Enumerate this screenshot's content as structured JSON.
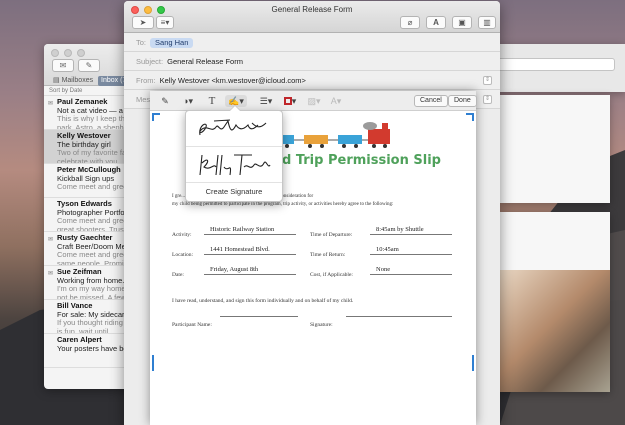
{
  "mail_list": {
    "mailboxes_label": "Mailboxes",
    "inbox_label": "Inbox (7)",
    "sort_label": "Sort by Date",
    "messages": [
      {
        "from": "Paul Zemanek",
        "subject": "Not a cat video — a new vid...",
        "preview": "This is why I keep the ball on my",
        "preview2": "park. Astro, a shepherd...",
        "flag": "envelope"
      },
      {
        "from": "Kelly Westover",
        "subject": "The birthday girl",
        "preview": "Two of my favorite faces and ones",
        "preview2": "celebrate with you.",
        "selected": true
      },
      {
        "from": "Peter McCullough",
        "subject": "Kickball Sign ups",
        "preview": "Come meet and greet, rookie players!",
        "preview2": ""
      },
      {
        "from": "Tyson Edwards",
        "subject": "Photographer Portfolio",
        "preview": "Come meet and greet, our featured",
        "preview2": "great shooters. Trust me..."
      },
      {
        "from": "Rusty Gaechter",
        "subject": "Craft Beer/Doom Metal",
        "preview": "Come meet and greet, this is the",
        "preview2": "same people. Promise...",
        "flag": "envelope"
      },
      {
        "from": "Sue Zeifman",
        "subject": "Working from home.",
        "preview": "I'm on my way home now, but I'll",
        "preview2": "not be missed. A few...",
        "flag": "envelope"
      },
      {
        "from": "Bill Vance",
        "subject": "For sale: My sidecar",
        "preview": "If you thought riding in the sidecar",
        "preview2": "is fun, wait until..."
      },
      {
        "from": "Caren Alpert",
        "subject": "Your posters have been",
        "preview": "",
        "preview2": ""
      }
    ]
  },
  "compose": {
    "window_title": "General Release Form",
    "to_label": "To:",
    "to_value": "Sang Han",
    "subject_label": "Subject:",
    "subject_value": "General Release Form",
    "from_label": "From:",
    "from_value": "Kelly Westover <km.westover@icloud.com>",
    "attach_label": "Mes"
  },
  "markup": {
    "cancel_label": "Cancel",
    "done_label": "Done",
    "text_tool": "T"
  },
  "document": {
    "title": "d Trip Permission Slip",
    "para1": "I gre...                                                  to participate in the following field trip and in consideration for",
    "para2": "my child being permitted to participate in the program, trip activity, or activities hereby agree to the following:",
    "activity_label": "Activity:",
    "activity_value": "Historic Railway Station",
    "departure_label": "Time of Departure:",
    "departure_value": "8:45am by Shuttle",
    "location_label": "Location:",
    "location_value": "1441 Homestead Blvd.",
    "return_label": "Time of Return:",
    "return_value": "10:45am",
    "date_label": "Date:",
    "date_value": "Friday, August 8th",
    "cost_label": "Cost, if Applicable:",
    "cost_value": "None",
    "statement": "I have read, understand, and sign this form individually and on behalf of my child.",
    "participant_label": "Participant Name:",
    "signature_label": "Signature:"
  },
  "signature_popover": {
    "create_label": "Create Signature"
  },
  "search_fragment": "h"
}
